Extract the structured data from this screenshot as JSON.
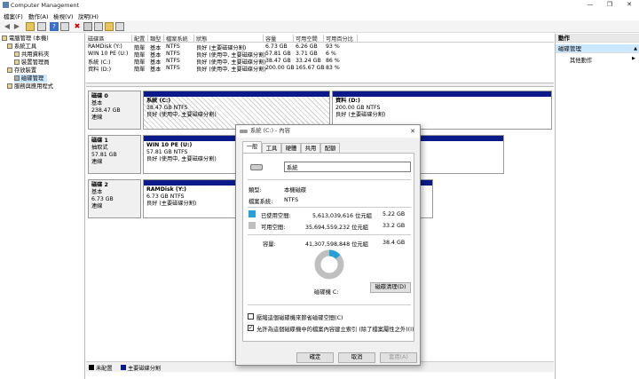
{
  "window": {
    "title": "Computer Management",
    "minimize": "—",
    "maximize": "❐",
    "close": "✕"
  },
  "menu": [
    "檔案(F)",
    "動作(A)",
    "檢視(V)",
    "說明(H)"
  ],
  "tree": {
    "items": [
      {
        "label": "電腦管理 (本機)",
        "level": 0
      },
      {
        "label": "系統工具",
        "level": 1
      },
      {
        "label": "共用資料夾",
        "level": 2
      },
      {
        "label": "裝置管理員",
        "level": 2
      },
      {
        "label": "存放裝置",
        "level": 1
      },
      {
        "label": "磁碟管理",
        "level": 2,
        "selected": true
      },
      {
        "label": "服務與應用程式",
        "level": 1
      }
    ]
  },
  "volume_table": {
    "headers": [
      "磁碟區",
      "配置",
      "類型",
      "檔案系統",
      "狀態",
      "容量",
      "可用空間",
      "可用百分比"
    ],
    "rows": [
      [
        "RAMDisk (Y:)",
        "簡單",
        "基本",
        "NTFS",
        "良好 (主要磁碟分割)",
        "6.73 GB",
        "6.26 GB",
        "93 %"
      ],
      [
        "WIN 10 PE (U:)",
        "簡單",
        "基本",
        "NTFS",
        "良好 (使用中, 主要磁碟分割)",
        "57.81 GB",
        "3.71 GB",
        "6 %"
      ],
      [
        "系統 (C:)",
        "簡單",
        "基本",
        "NTFS",
        "良好 (使用中, 主要磁碟分割)",
        "38.47 GB",
        "33.24 GB",
        "86 %"
      ],
      [
        "資料 (D:)",
        "簡單",
        "基本",
        "NTFS",
        "良好 (使用中, 主要磁碟分割)",
        "200.00 GB",
        "165.67 GB",
        "83 %"
      ]
    ]
  },
  "disks": [
    {
      "name": "磁碟 0",
      "type": "基本",
      "size": "238.47 GB",
      "status": "連線",
      "partitions": [
        {
          "name": "系統  (C:)",
          "size": "38.47 GB NTFS",
          "status": "良好 (使用中, 主要磁碟分割)"
        },
        {
          "name": "資料  (D:)",
          "size": "200.00 GB NTFS",
          "status": "良好 (主要磁碟分割)"
        }
      ]
    },
    {
      "name": "磁碟 1",
      "type": "抽取式",
      "size": "57.81 GB",
      "status": "連線",
      "partitions": [
        {
          "name": "WIN 10 PE  (U:)",
          "size": "57.81 GB NTFS",
          "status": "良好 (使用中, 主要磁碟分割)"
        }
      ]
    },
    {
      "name": "磁碟 2",
      "type": "基本",
      "size": "6.73 GB",
      "status": "連線",
      "partitions": [
        {
          "name": "RAMDisk  (Y:)",
          "size": "6.73 GB NTFS",
          "status": "良好 (主要磁碟分割)"
        }
      ]
    }
  ],
  "legend": [
    {
      "label": "未配置",
      "color": "#000000"
    },
    {
      "label": "主要磁碟分割",
      "color": "#0a1a8a"
    }
  ],
  "actions": {
    "header": "動作",
    "section": "磁碟管理",
    "item": "其他動作",
    "arrow_up": "▲",
    "arrow_right": "▶"
  },
  "dialog": {
    "title": "系統 (C:) - 內容",
    "tabs": [
      "一般",
      "工具",
      "硬體",
      "共用",
      "配額"
    ],
    "active_tab": "一般",
    "volume_name": "系統",
    "type_label": "類型:",
    "type_value": "本機磁碟",
    "fs_label": "檔案系統:",
    "fs_value": "NTFS",
    "used_label": "已使用空間:",
    "used_bytes": "5,613,039,616 位元組",
    "used_gb": "5.22 GB",
    "free_label": "可用空間:",
    "free_bytes": "35,694,559,232 位元組",
    "free_gb": "33.2 GB",
    "cap_label": "容量:",
    "cap_bytes": "41,307,598,848 位元組",
    "cap_gb": "38.4 GB",
    "used_fraction": 0.136,
    "used_color": "#26a0da",
    "free_color": "#bfbfbf",
    "drive_label": "磁碟機 C:",
    "cleanup_button": "磁碟清理(D)",
    "compress_label": "壓縮這個磁碟機來節省磁碟空間(C)",
    "compress_checked": false,
    "index_label": "允許為這個磁碟機中的檔案內容建立索引 (除了檔案屬性之外)(I)",
    "index_checked": true,
    "check_mark": "✓",
    "ok": "確定",
    "cancel": "取消",
    "apply": "套用(A)"
  }
}
